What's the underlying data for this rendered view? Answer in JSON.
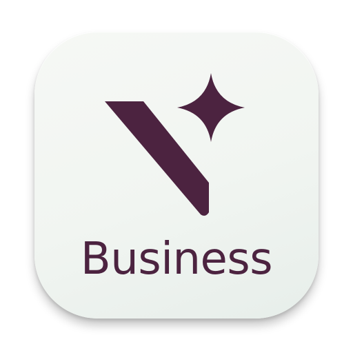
{
  "app": {
    "name": "Business"
  },
  "colors": {
    "brand": "#4c2340",
    "background_light": "#f6f8f5",
    "background_tint": "#e7eeea"
  },
  "icons": {
    "mark": "v-with-sparkle-icon"
  }
}
